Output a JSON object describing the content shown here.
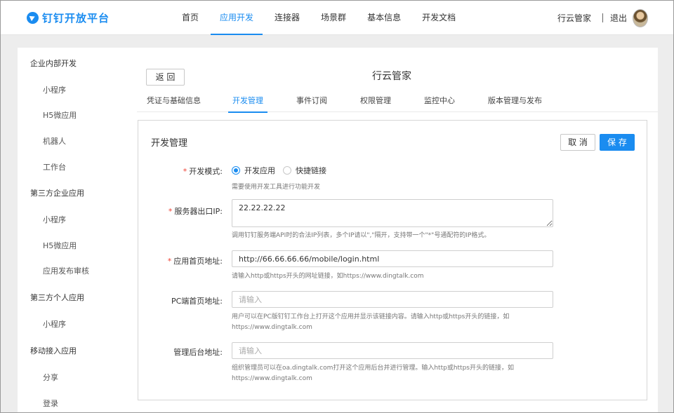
{
  "header": {
    "logo_text": "钉钉开放平台",
    "nav": [
      "首页",
      "应用开发",
      "连接器",
      "场景群",
      "基本信息",
      "开发文档"
    ],
    "nav_active": "应用开发",
    "org_name": "行云管家",
    "logout": "退出"
  },
  "sidebar": {
    "groups": [
      {
        "title": "企业内部开发",
        "items": [
          "小程序",
          "H5微应用",
          "机器人",
          "工作台"
        ]
      },
      {
        "title": "第三方企业应用",
        "items": [
          "小程序",
          "H5微应用",
          "应用发布审核"
        ]
      },
      {
        "title": "第三方个人应用",
        "items": [
          "小程序"
        ]
      },
      {
        "title": "移动接入应用",
        "items": [
          "分享",
          "登录"
        ]
      }
    ]
  },
  "page": {
    "back": "返 回",
    "app_title": "行云管家",
    "tabs": [
      "凭证与基础信息",
      "开发管理",
      "事件订阅",
      "权限管理",
      "监控中心",
      "版本管理与发布"
    ],
    "tab_active": "开发管理"
  },
  "form": {
    "title": "开发管理",
    "cancel": "取 消",
    "save": "保 存",
    "dev_mode": {
      "label": "开发模式:",
      "options": [
        "开发应用",
        "快捷链接"
      ],
      "selected": "开发应用",
      "hint": "需要使用开发工具进行功能开发"
    },
    "server_ip": {
      "label": "服务器出口IP:",
      "value": "22.22.22.22",
      "hint": "调用钉钉服务端API时的合法IP列表，多个IP请以\",\"隔开，支持带一个\"*\"号通配符的IP格式。"
    },
    "home_url": {
      "label": "应用首页地址:",
      "value": "http://66.66.66.66/mobile/login.html",
      "hint": "请输入http或https开头的网址链接，如https://www.dingtalk.com"
    },
    "pc_url": {
      "label": "PC端首页地址:",
      "placeholder": "请输入",
      "hint_line1": "用户可以在PC版钉钉工作台上打开这个应用并显示该链接内容。请输入http或https开头的链接，如",
      "hint_line2": "https://www.dingtalk.com"
    },
    "admin_url": {
      "label": "管理后台地址:",
      "placeholder": "请输入",
      "hint_line1": "组织管理员可以在oa.dingtalk.com打开这个应用后台并进行管理。输入http或https开头的链接，如",
      "hint_line2": "https://www.dingtalk.com"
    }
  },
  "colors": {
    "accent": "#1a8cf0",
    "required": "#f04134"
  }
}
